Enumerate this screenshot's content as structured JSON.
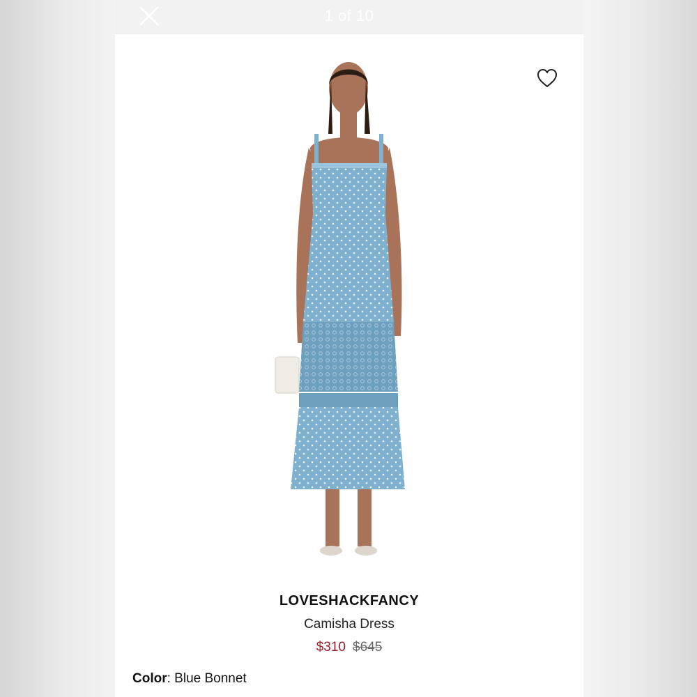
{
  "viewer": {
    "counter": "1 of 10",
    "close_icon": "close-icon",
    "favorite_icon": "heart-outline-icon"
  },
  "product": {
    "brand": "LOVESHACKFANCY",
    "name": "Camisha Dress",
    "sale_price": "$310",
    "original_price": "$645",
    "color_label": "Color",
    "color_separator": ":",
    "color_value": "Blue Bonnet"
  },
  "colors": {
    "sale": "#9a1d2a",
    "dress": "#7fb1cf"
  }
}
